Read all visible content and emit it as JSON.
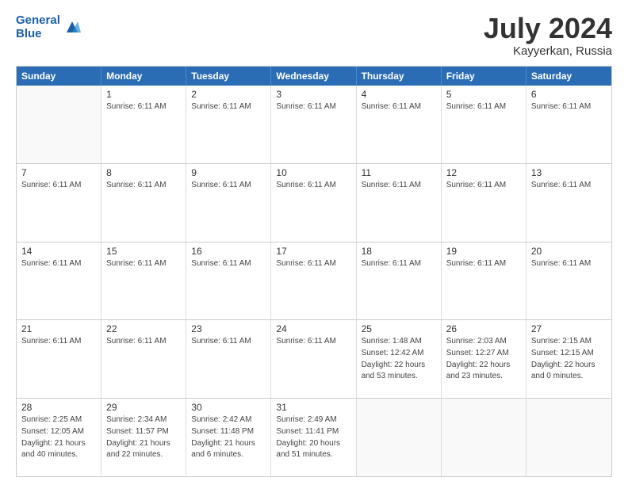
{
  "header": {
    "logo_line1": "General",
    "logo_line2": "Blue",
    "month_title": "July 2024",
    "location": "Kayyerkan, Russia"
  },
  "days_of_week": [
    "Sunday",
    "Monday",
    "Tuesday",
    "Wednesday",
    "Thursday",
    "Friday",
    "Saturday"
  ],
  "weeks": [
    [
      {
        "day": "",
        "info": []
      },
      {
        "day": "1",
        "info": [
          "Sunrise: 6:11 AM"
        ]
      },
      {
        "day": "2",
        "info": [
          "Sunrise: 6:11 AM"
        ]
      },
      {
        "day": "3",
        "info": [
          "Sunrise: 6:11 AM"
        ]
      },
      {
        "day": "4",
        "info": [
          "Sunrise: 6:11 AM"
        ]
      },
      {
        "day": "5",
        "info": [
          "Sunrise: 6:11 AM"
        ]
      },
      {
        "day": "6",
        "info": [
          "Sunrise: 6:11 AM"
        ]
      }
    ],
    [
      {
        "day": "7",
        "info": [
          "Sunrise: 6:11 AM"
        ]
      },
      {
        "day": "8",
        "info": [
          "Sunrise: 6:11 AM"
        ]
      },
      {
        "day": "9",
        "info": [
          "Sunrise: 6:11 AM"
        ]
      },
      {
        "day": "10",
        "info": [
          "Sunrise: 6:11 AM"
        ]
      },
      {
        "day": "11",
        "info": [
          "Sunrise: 6:11 AM"
        ]
      },
      {
        "day": "12",
        "info": [
          "Sunrise: 6:11 AM"
        ]
      },
      {
        "day": "13",
        "info": [
          "Sunrise: 6:11 AM"
        ]
      }
    ],
    [
      {
        "day": "14",
        "info": [
          "Sunrise: 6:11 AM"
        ]
      },
      {
        "day": "15",
        "info": [
          "Sunrise: 6:11 AM"
        ]
      },
      {
        "day": "16",
        "info": [
          "Sunrise: 6:11 AM"
        ]
      },
      {
        "day": "17",
        "info": [
          "Sunrise: 6:11 AM"
        ]
      },
      {
        "day": "18",
        "info": [
          "Sunrise: 6:11 AM"
        ]
      },
      {
        "day": "19",
        "info": [
          "Sunrise: 6:11 AM"
        ]
      },
      {
        "day": "20",
        "info": [
          "Sunrise: 6:11 AM"
        ]
      }
    ],
    [
      {
        "day": "21",
        "info": [
          "Sunrise: 6:11 AM"
        ]
      },
      {
        "day": "22",
        "info": [
          "Sunrise: 6:11 AM"
        ]
      },
      {
        "day": "23",
        "info": [
          "Sunrise: 6:11 AM"
        ]
      },
      {
        "day": "24",
        "info": [
          "Sunrise: 6:11 AM"
        ]
      },
      {
        "day": "25",
        "info": [
          "Sunrise: 1:48 AM",
          "Sunset: 12:42 AM",
          "Daylight: 22 hours and 53 minutes."
        ]
      },
      {
        "day": "26",
        "info": [
          "Sunrise: 2:03 AM",
          "Sunset: 12:27 AM",
          "Daylight: 22 hours and 23 minutes."
        ]
      },
      {
        "day": "27",
        "info": [
          "Sunrise: 2:15 AM",
          "Sunset: 12:15 AM",
          "Daylight: 22 hours and 0 minutes."
        ]
      }
    ],
    [
      {
        "day": "28",
        "info": [
          "Sunrise: 2:25 AM",
          "Sunset: 12:05 AM",
          "Daylight: 21 hours and 40 minutes."
        ]
      },
      {
        "day": "29",
        "info": [
          "Sunrise: 2:34 AM",
          "Sunset: 11:57 PM",
          "Daylight: 21 hours and 22 minutes."
        ]
      },
      {
        "day": "30",
        "info": [
          "Sunrise: 2:42 AM",
          "Sunset: 11:48 PM",
          "Daylight: 21 hours and 6 minutes."
        ]
      },
      {
        "day": "31",
        "info": [
          "Sunrise: 2:49 AM",
          "Sunset: 11:41 PM",
          "Daylight: 20 hours and 51 minutes."
        ]
      },
      {
        "day": "",
        "info": []
      },
      {
        "day": "",
        "info": []
      },
      {
        "day": "",
        "info": []
      }
    ]
  ]
}
